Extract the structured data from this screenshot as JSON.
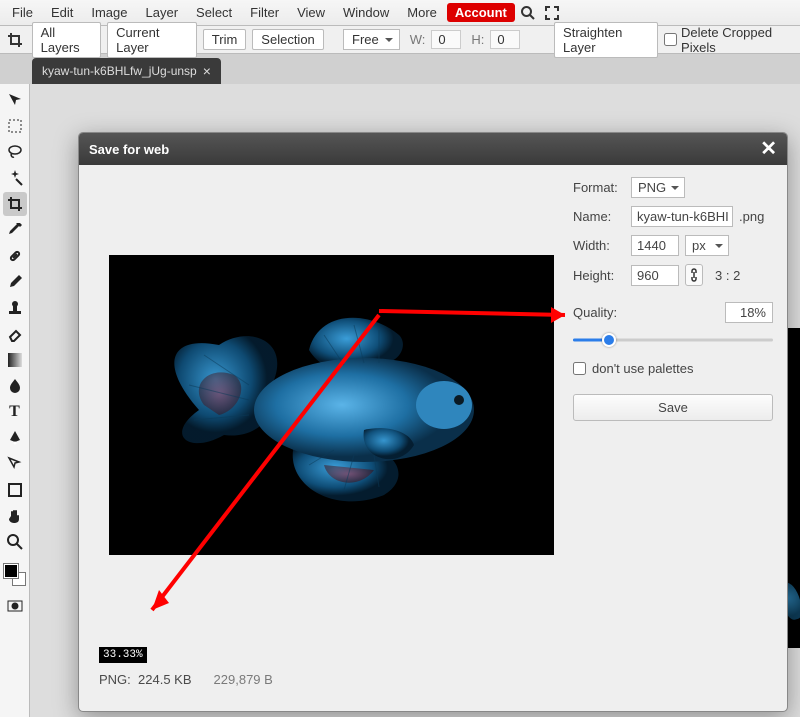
{
  "menubar": {
    "items": [
      "File",
      "Edit",
      "Image",
      "Layer",
      "Select",
      "Filter",
      "View",
      "Window",
      "More"
    ],
    "account": "Account"
  },
  "options": {
    "all_layers": "All Layers",
    "current_layer": "Current Layer",
    "trim": "Trim",
    "selection": "Selection",
    "ratio": "Free",
    "w_label": "W:",
    "w_val": "0",
    "h_label": "H:",
    "h_val": "0",
    "straighten": "Straighten Layer",
    "delete_cropped": "Delete Cropped Pixels"
  },
  "tab": {
    "filename": "kyaw-tun-k6BHLfw_jUg-unsp"
  },
  "dialog": {
    "title": "Save for web",
    "format_label": "Format:",
    "format_value": "PNG",
    "name_label": "Name:",
    "name_value": "kyaw-tun-k6BHI",
    "name_ext": ".png",
    "width_label": "Width:",
    "width_value": "1440",
    "width_unit": "px",
    "height_label": "Height:",
    "height_value": "960",
    "ratio": "3 : 2",
    "quality_label": "Quality:",
    "quality_value": "18%",
    "quality_pct": 18,
    "palettes_label": "don't use palettes",
    "save_label": "Save",
    "zoom": "33.33%",
    "status_fmt": "PNG:",
    "status_size": "224.5 KB",
    "status_bytes": "229,879 B"
  }
}
